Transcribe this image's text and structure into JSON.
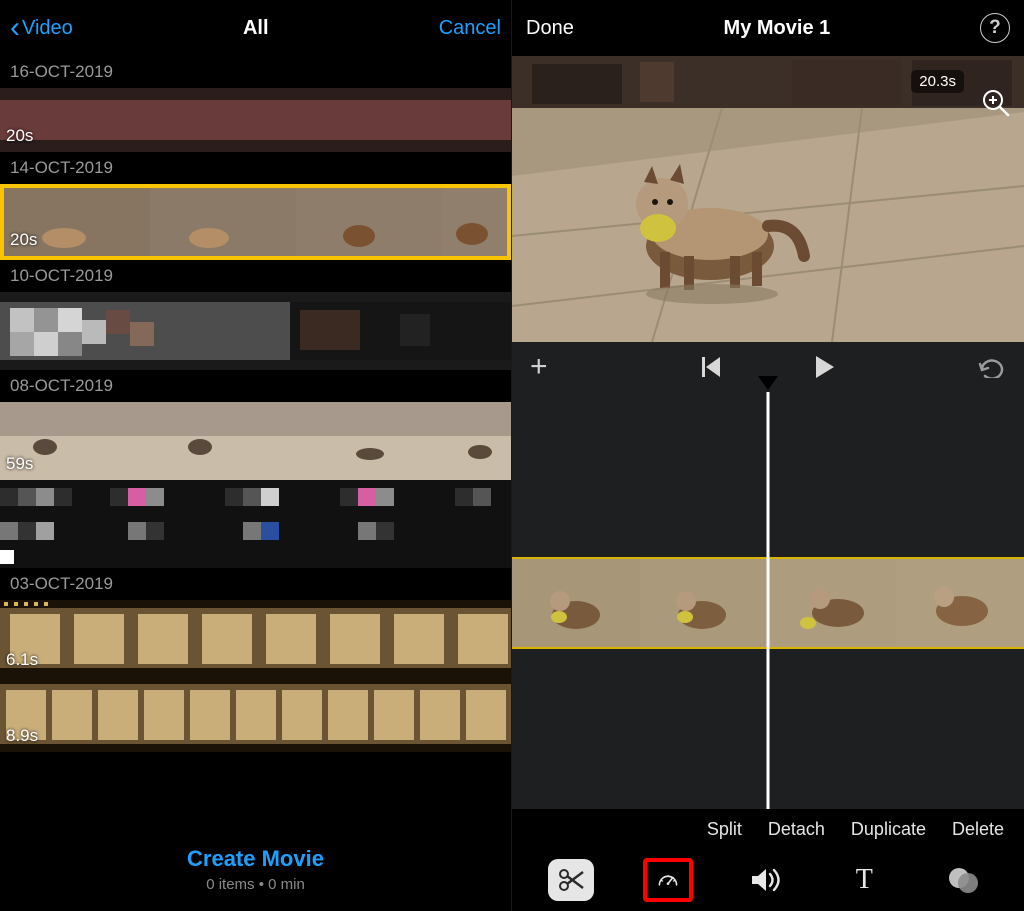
{
  "left": {
    "back_label": "Video",
    "title": "All",
    "cancel_label": "Cancel",
    "sections": [
      {
        "date": "16-OCT-2019",
        "duration": "20s"
      },
      {
        "date": "14-OCT-2019",
        "duration": "20s"
      },
      {
        "date": "10-OCT-2019"
      },
      {
        "date": "08-OCT-2019",
        "duration": "59s"
      },
      {
        "date": "03-OCT-2019",
        "durations": [
          "6.1s",
          "8.9s"
        ]
      }
    ],
    "create_label": "Create Movie",
    "footer_sub": "0 items • 0 min"
  },
  "right": {
    "done_label": "Done",
    "title": "My Movie 1",
    "help": "?",
    "preview_time": "20.3s",
    "tool_labels": [
      "Split",
      "Detach",
      "Duplicate",
      "Delete"
    ]
  },
  "colors": {
    "accent_blue": "#1ea0ff",
    "select_yellow": "#f7c600",
    "highlight_red": "#ff0000"
  }
}
